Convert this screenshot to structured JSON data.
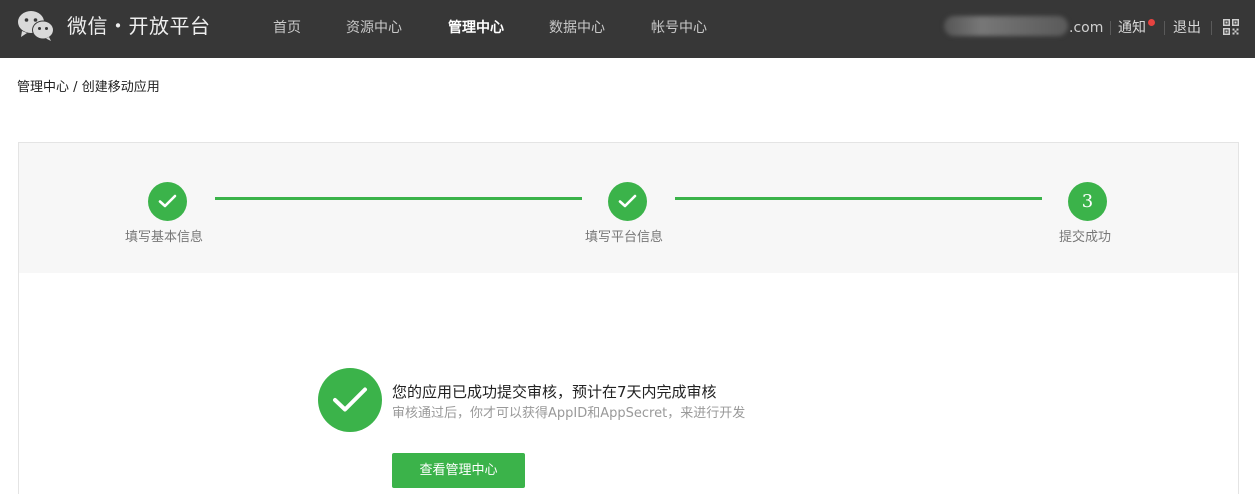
{
  "header": {
    "brand": "微信・开放平台",
    "nav": [
      {
        "label": "首页",
        "active": false
      },
      {
        "label": "资源中心",
        "active": false
      },
      {
        "label": "管理中心",
        "active": true
      },
      {
        "label": "数据中心",
        "active": false
      },
      {
        "label": "帐号中心",
        "active": false
      }
    ],
    "account_domain": ".com",
    "notify_label": "通知",
    "logout_label": "退出",
    "icons": {
      "logo": "wechat-logo-icon",
      "qr": "qr-code-icon",
      "notify": "unread-dot"
    }
  },
  "breadcrumb": {
    "parent": "管理中心",
    "separator": "/",
    "current": "创建移动应用"
  },
  "steps": [
    {
      "label": "填写基本信息",
      "state": "done"
    },
    {
      "label": "填写平台信息",
      "state": "done"
    },
    {
      "label": "提交成功",
      "state": "current",
      "number": "3"
    }
  ],
  "result": {
    "title": "您的应用已成功提交审核，预计在7天内完成审核",
    "subtitle": "审核通过后，你才可以获得AppID和AppSecret，来进行开发",
    "button_label": "查看管理中心"
  },
  "colors": {
    "topbar": "#373737",
    "accent_green": "#3bb34a",
    "steps_bg": "#f7f7f7",
    "notify_dot": "#e64340"
  }
}
